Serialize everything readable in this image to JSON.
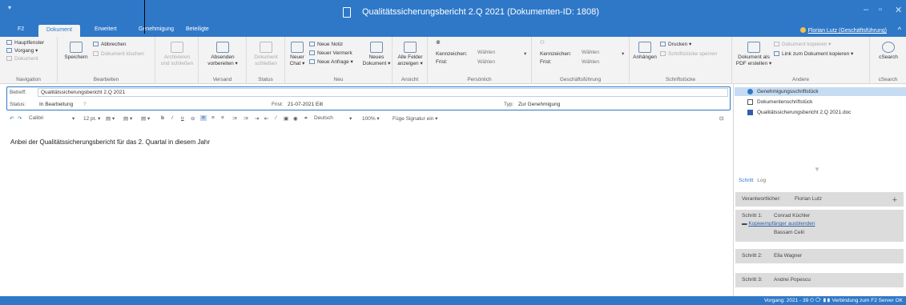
{
  "window": {
    "logo_label": "▾",
    "title": "Qualitätssicherungsbericht 2.Q 2021 (Dokumenten-ID: 1808)",
    "minimize": "–",
    "maximize": "▫",
    "close": "✕"
  },
  "tabs": {
    "items": [
      "F2",
      "Dokument",
      "Erweitert",
      "Genehmigung",
      "Beteiligte"
    ],
    "active": "Dokument"
  },
  "user": {
    "name": "Florian Lutz (Geschäftsführung)"
  },
  "ribbon": {
    "navigation": {
      "label": "Navigation",
      "hauptfenster": "Hauptfenster",
      "vorgang": "Vorgang ▾",
      "dokument": "Dokument"
    },
    "bearbeiten": {
      "label": "Bearbeiten",
      "speichern": "Speichern",
      "abbrechen": "Abbrechen",
      "loeschen": "Dokument löschen"
    },
    "archivieren": {
      "line1": "Archivieren",
      "line2": "und schließen"
    },
    "versand": {
      "label": "Versand",
      "line1": "Absenden",
      "line2": "vorbereiten ▾"
    },
    "status": {
      "label": "Status",
      "line1": "Dokument",
      "line2": "schließen"
    },
    "neu": {
      "label": "Neu",
      "chat_l1": "Neuer",
      "chat_l2": "Chat ▾",
      "notiz": "Neue Notiz",
      "vermerk": "Neuer Vermerk",
      "anfrage": "Neue Anfrage ▾",
      "dok_l1": "Neues",
      "dok_l2": "Dokument ▾"
    },
    "ansicht": {
      "label": "Ansicht",
      "line1": "Alle Felder",
      "line2": "anzeigen ▾"
    },
    "persoenlich": {
      "label": "Persönlich",
      "kennzeichen": "Kennzeichen:",
      "frist": "Frist:",
      "waehlen": "Wählen"
    },
    "geschaeftsfuehrung": {
      "label": "Geschäftsführung",
      "kennzeichen": "Kennzeichen:",
      "frist": "Frist:",
      "waehlen": "Wählen"
    },
    "schriftstuecke": {
      "label": "Schriftstücke",
      "anhaengen": "Anhängen",
      "drucken": "Drucken ▾",
      "sperren": "Schriftstücke sperren"
    },
    "andere": {
      "label": "Andere",
      "pdf_l1": "Dokument als",
      "pdf_l2": "PDF erstellen ▾",
      "kopieren": "Dokument kopieren ▾",
      "link": "Link zum Dokument kopieren ▾"
    },
    "csearch": {
      "label": "cSearch",
      "button": "cSearch"
    }
  },
  "props": {
    "betreff_label": "Betreff:",
    "betreff_value": "Qualitätssicherungsbericht 2.Q 2021",
    "status_label": "Status:",
    "status_value": "In Bearbeitung",
    "help": "?",
    "frist_label": "Frist:",
    "frist_value": "21-07-2021 Eilt",
    "typ_label": "Typ:",
    "typ_value": "Zur Genehmigung"
  },
  "editor": {
    "undo": "↶",
    "redo": "↷",
    "font": "Calibri",
    "font_arrow": "▾",
    "size": "12 pt. ▾",
    "bold": "b",
    "italic": "/",
    "underline": "u",
    "language": "Deutsch",
    "zoom": "100% ▾",
    "signature": "Füge Signatur ein ▾",
    "body": "Anbei der Qualitätssicherungsbericht für das 2. Quartal in diesem Jahr"
  },
  "right_pane": {
    "documents": [
      "Genehmigungsschriftstück",
      "Dokumentenschriftstück",
      "Qualitätssicherungsbericht 2.Q 2021.doc"
    ],
    "tab_schritt": "Schritt",
    "tab_log": "Log",
    "verantwortlicher_label": "Verantwortlicher:",
    "verantwortlicher_value": "Florian Lutz",
    "plus": "+",
    "steps": [
      {
        "label": "Schritt 1:",
        "person": "Conrad Küchler"
      },
      {
        "label": "Schritt 2:",
        "person": "Ella Wagner"
      },
      {
        "label": "Schritt 3:",
        "person": "Andrei Popescu"
      }
    ],
    "kopie_link": "Kopieempfänger ausblenden",
    "kopie_person": "Bassam Celil"
  },
  "statusbar": {
    "text": "Vorgang: 2021 - 39 ⏻ ⟳ ▮▮   Verbindung zum F2 Server OK"
  }
}
